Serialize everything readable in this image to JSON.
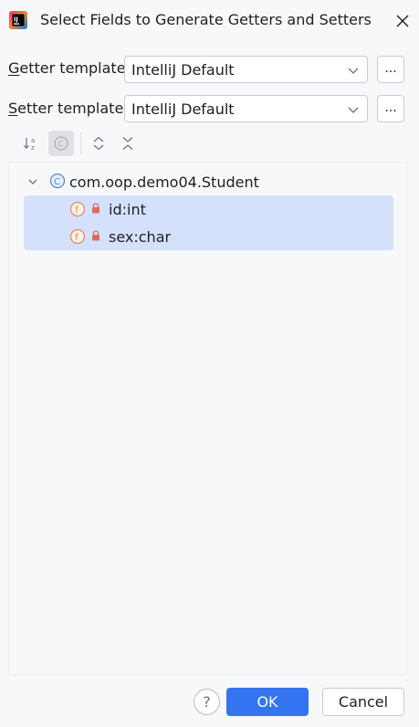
{
  "dialog": {
    "title": "Select Fields to Generate Getters and Setters",
    "app_icon": "intellij-icon",
    "close_icon": "close-icon"
  },
  "getter": {
    "label_first": "G",
    "label_rest": "etter template:",
    "value": "IntelliJ Default",
    "more_label": "..."
  },
  "setter": {
    "label_first": "S",
    "label_rest": "etter template:",
    "value": "IntelliJ Default",
    "more_label": "..."
  },
  "toolbar": {
    "items": [
      "sort-alphabetically-icon",
      "show-classes-icon",
      "expand-all-icon",
      "collapse-all-icon"
    ]
  },
  "tree": {
    "root": {
      "label": "com.oop.demo04.Student",
      "icon": "class-icon",
      "expanded": true
    },
    "fields": [
      {
        "label": "id:int",
        "icon": "field-icon",
        "visibility": "private",
        "selected": true
      },
      {
        "label": "sex:char",
        "icon": "field-icon",
        "visibility": "private",
        "selected": true
      }
    ]
  },
  "footer": {
    "help_label": "?",
    "ok_label": "OK",
    "cancel_label": "Cancel"
  },
  "colors": {
    "accent": "#3574f0",
    "selection": "#d5e1fb",
    "field_icon": "#e8855a",
    "class_icon": "#4a86e8",
    "lock": "#e06b5c"
  }
}
